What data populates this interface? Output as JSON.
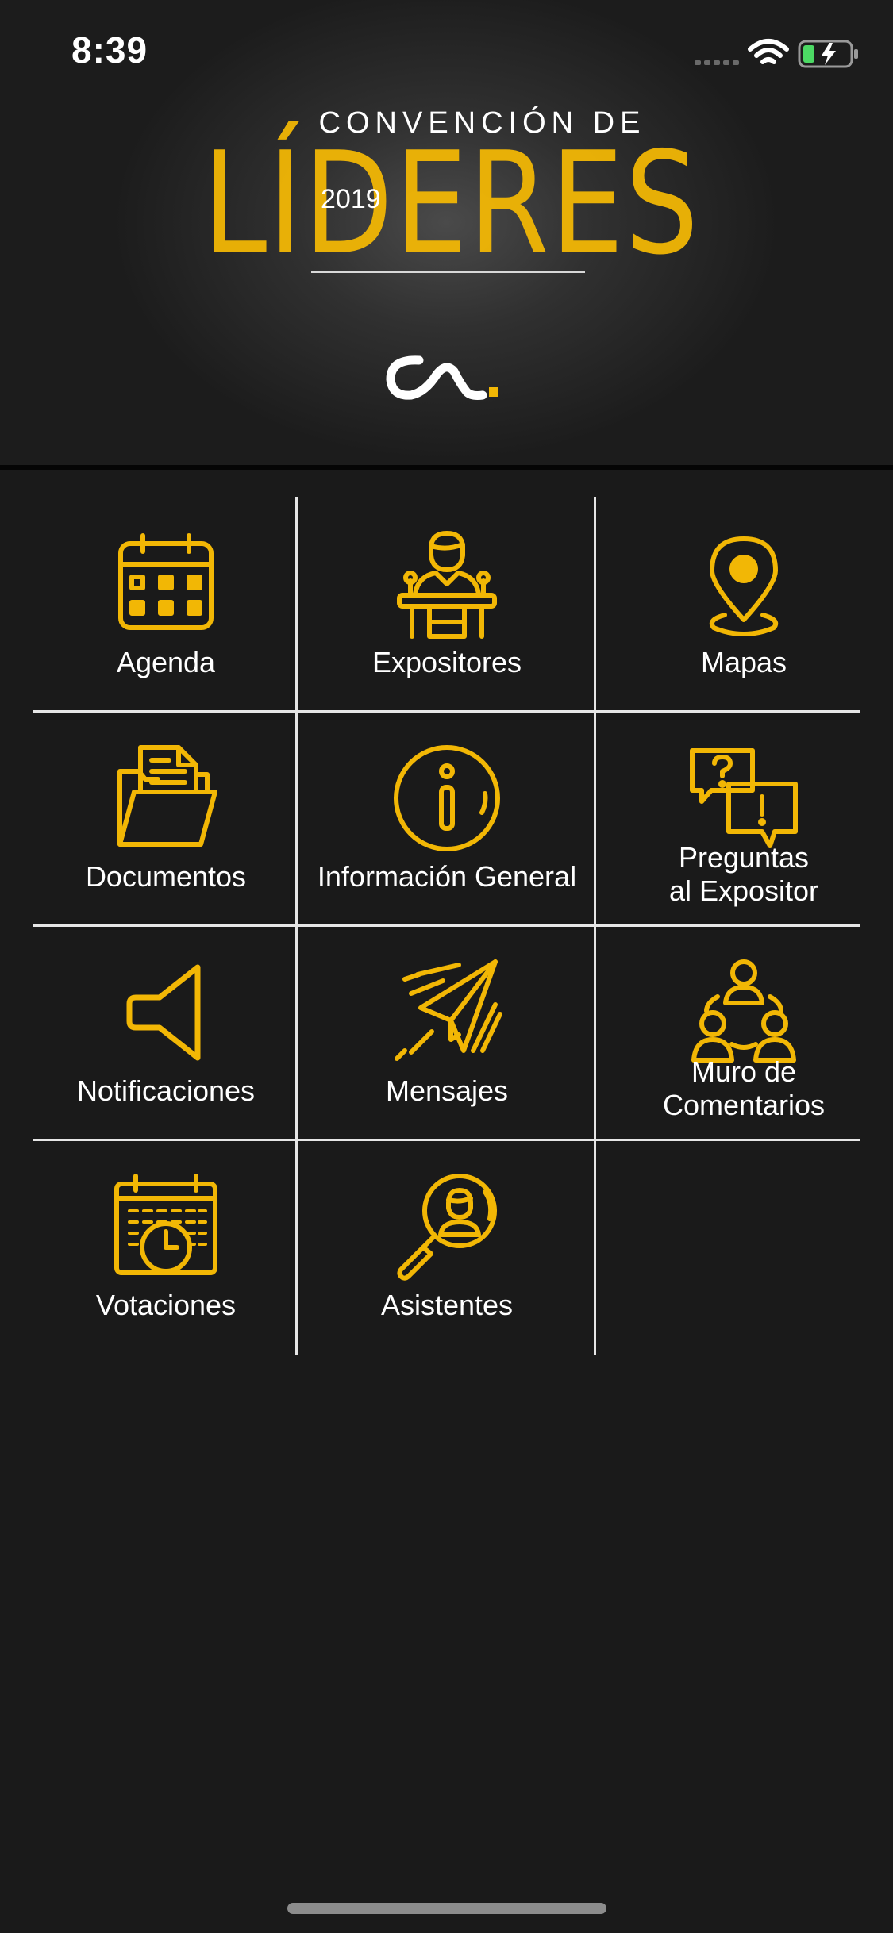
{
  "status_bar": {
    "time": "8:39",
    "icons": [
      "signal-dots-icon",
      "wifi-icon",
      "battery-charging-icon"
    ]
  },
  "header": {
    "logo_top_line": "CONVENCIÓN DE",
    "logo_main": "LÍDERES",
    "logo_year": "2019",
    "brand_mark_icon": "cl-brand-logo-icon"
  },
  "colors": {
    "accent": "#f2b705",
    "background": "#1a1a1a",
    "divider": "#e6e6e6"
  },
  "menu": {
    "items": [
      {
        "label": "Agenda",
        "icon": "calendar-icon"
      },
      {
        "label": "Expositores",
        "icon": "speaker-podium-icon"
      },
      {
        "label": "Mapas",
        "icon": "map-pin-icon"
      },
      {
        "label": "Documentos",
        "icon": "folder-documents-icon"
      },
      {
        "label": "Información General",
        "icon": "info-icon"
      },
      {
        "label_line1": "Preguntas",
        "label_line2": "al Expositor",
        "icon": "question-chat-icon"
      },
      {
        "label": "Notificaciones",
        "icon": "megaphone-icon"
      },
      {
        "label": "Mensajes",
        "icon": "paper-plane-icon"
      },
      {
        "label_line1": "Muro de",
        "label_line2": "Comentarios",
        "icon": "people-network-icon"
      },
      {
        "label": "Votaciones",
        "icon": "calendar-clock-icon"
      },
      {
        "label": "Asistentes",
        "icon": "search-person-icon"
      }
    ]
  }
}
